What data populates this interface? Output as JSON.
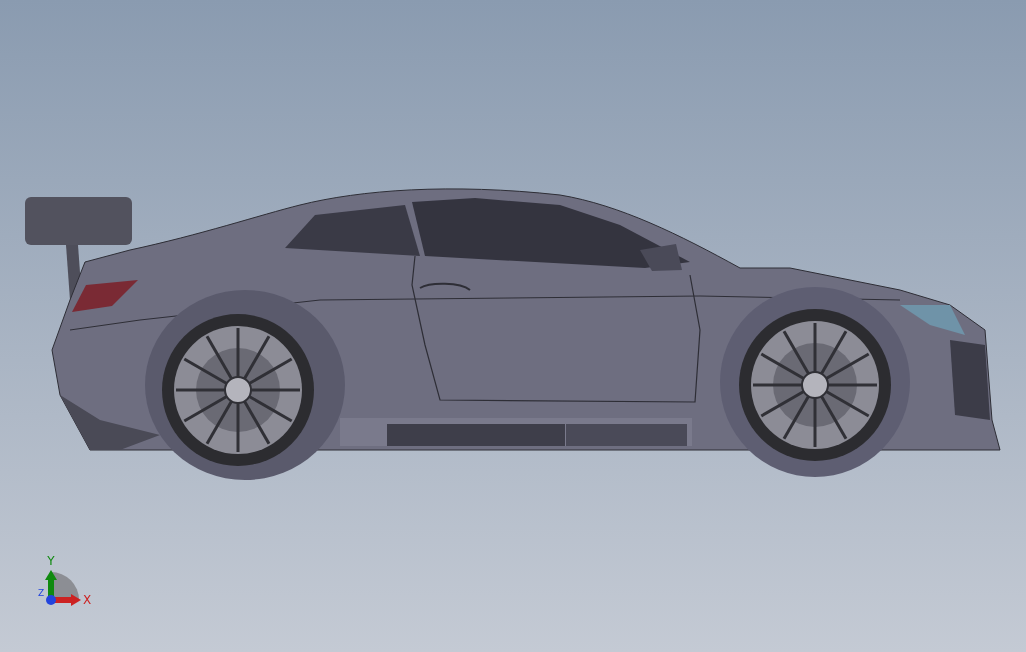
{
  "viewport": {
    "triad": {
      "axes": [
        {
          "kind": "vertical",
          "label": "Y",
          "color": "#0f8a0f"
        },
        {
          "kind": "horizontal",
          "label": "X",
          "color": "#cc2222"
        },
        {
          "kind": "depth",
          "label": "Z",
          "color": "#2244dd"
        }
      ]
    }
  }
}
